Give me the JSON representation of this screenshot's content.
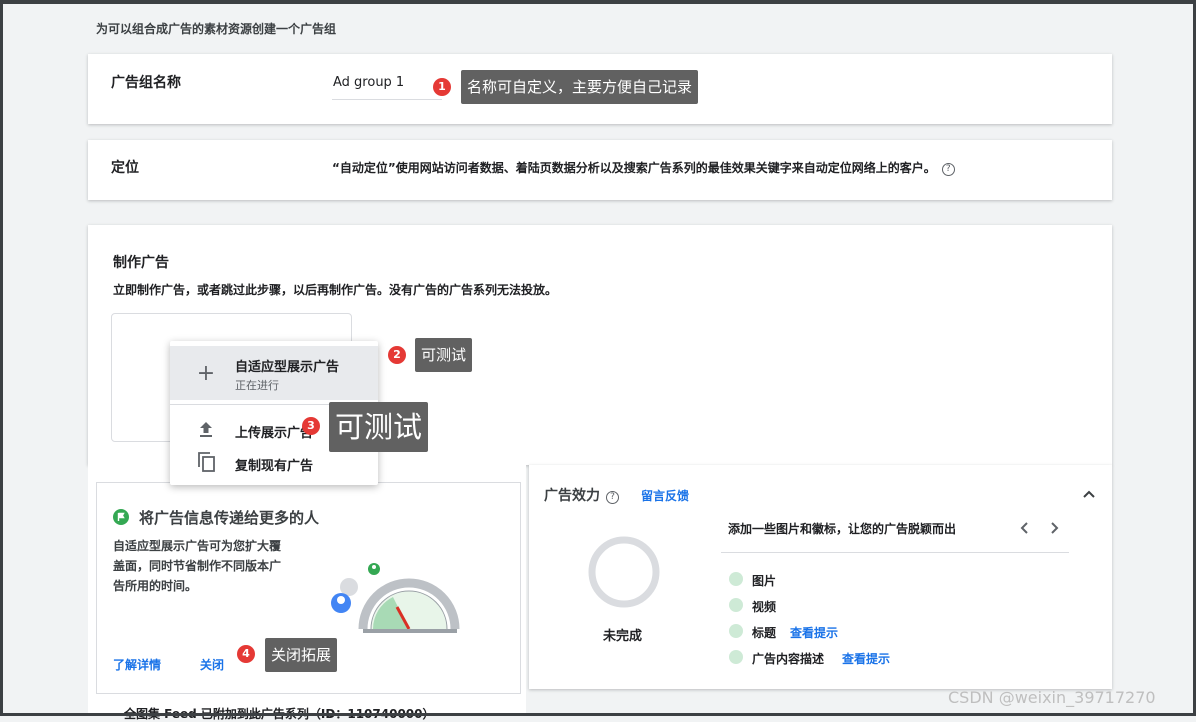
{
  "page_title": "为可以组合成广告的素材资源创建一个广告组",
  "ad_group": {
    "label": "广告组名称",
    "value": "Ad group 1",
    "annotation_number": "1",
    "annotation_text": "名称可自定义，主要方便自己记录"
  },
  "targeting": {
    "label": "定位",
    "text": "“自动定位”使用网站访问者数据、着陆页数据分析以及搜索广告系列的最佳效果关键字来自动定位网络上的客户。",
    "help_glyph": "?"
  },
  "create_ad": {
    "title": "制作广告",
    "subtitle": "立即制作广告，或者跳过此步骤，以后再制作广告。没有广告的广告系列无法投放。"
  },
  "menu": {
    "items": [
      {
        "label": "自适应型展示广告",
        "sub": "正在进行",
        "icon": "plus-icon"
      },
      {
        "label": "上传展示广告",
        "icon": "upload-icon"
      },
      {
        "label": "复制现有广告",
        "icon": "copy-icon"
      }
    ]
  },
  "annotations": {
    "a2_number": "2",
    "a2_text": "可测试",
    "a3_number": "3",
    "a3_text": "可测试",
    "a4_number": "4",
    "a4_text": "关闭拓展"
  },
  "promo": {
    "title": "将广告信息传递给更多的人",
    "body_line1": "自适应型展示广告可为您扩大覆",
    "body_line2": "盖面，同时节省制作不同版本广",
    "body_line3": "告所用的时间。",
    "learn_more": "了解详情",
    "close": "关闭",
    "cut_text": "全图集 Feed 已附加到此广告系列（ID：110740000）"
  },
  "effect": {
    "title": "广告效力",
    "feedback": "留言反馈",
    "status": "未完成",
    "hint": "添加一些图片和徽标，让您的广告脱颖而出",
    "checklist": [
      {
        "label": "图片",
        "link": ""
      },
      {
        "label": "视频",
        "link": ""
      },
      {
        "label": "标题",
        "link": "查看提示"
      },
      {
        "label": "广告内容描述",
        "link": "查看提示"
      }
    ]
  },
  "watermark": "CSDN @weixin_39717270",
  "colors": {
    "accent": "#1a73e8",
    "badge": "#e53935",
    "tooltip": "#616161",
    "progress_ring": "#dadce0",
    "check_dot": "#ceead6",
    "flag": "#34a853"
  }
}
